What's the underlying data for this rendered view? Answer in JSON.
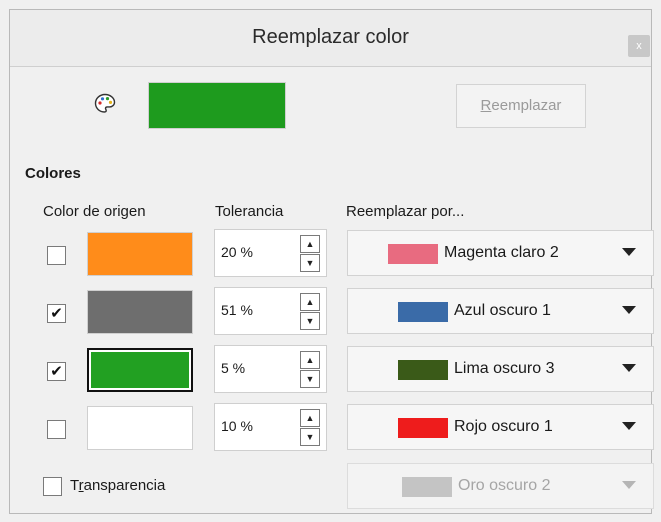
{
  "dialog": {
    "title": "Reemplazar color",
    "close_label": "x"
  },
  "top": {
    "pipette_icon": "palette-pipette-icon",
    "source_color": "#1e9b1e",
    "replace_button": {
      "underlined": "R",
      "rest": "eemplazar"
    }
  },
  "colors": {
    "section_title": "Colores",
    "headers": {
      "source": "Color de origen",
      "tolerance": "Tolerancia",
      "replace_with": "Reemplazar por..."
    },
    "rows": [
      {
        "checked": false,
        "check_mark": "",
        "source_color": "#ff8c1a",
        "tolerance": "20 %",
        "replace_label": "Magenta claro 2",
        "replace_color": "#e86b80"
      },
      {
        "checked": true,
        "check_mark": "✔",
        "source_color": "#6e6e6e",
        "tolerance": "51 %",
        "replace_label": "Azul oscuro 1",
        "replace_color": "#3a6ba8"
      },
      {
        "checked": true,
        "check_mark": "✔",
        "source_color": "#22a022",
        "tolerance": "5 %",
        "replace_label": "Lima oscuro 3",
        "replace_color": "#3a5a18"
      },
      {
        "checked": false,
        "check_mark": "",
        "source_color": "#ffffff",
        "tolerance": "10 %",
        "replace_label": "Rojo oscuro 1",
        "replace_color": "#ee1c1c"
      }
    ]
  },
  "transparency": {
    "label_prefix": "T",
    "label_underlined": "r",
    "label_rest": "ansparencia",
    "checked": false,
    "replace_label": "Oro oscuro 2",
    "replace_color": "#c4c4c4"
  }
}
